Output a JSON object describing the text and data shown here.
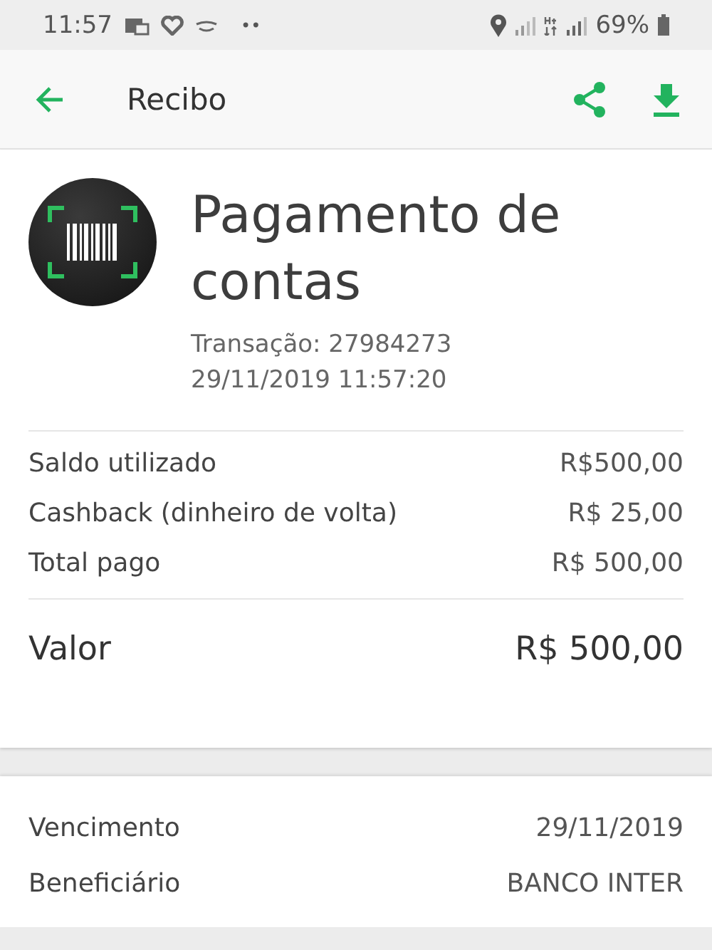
{
  "status_bar": {
    "time": "11:57",
    "notification_dots": "••",
    "battery": "69%"
  },
  "app_bar": {
    "title": "Recibo"
  },
  "receipt": {
    "title": "Pagamento de contas",
    "transaction": "Transação: 27984273",
    "datetime": "29/11/2019 11:57:20",
    "lines": [
      {
        "label": "Saldo utilizado",
        "value": "R$500,00"
      },
      {
        "label": "Cashback (dinheiro de volta)",
        "value": "R$ 25,00"
      },
      {
        "label": "Total pago",
        "value": "R$ 500,00"
      }
    ],
    "total": {
      "label": "Valor",
      "value": "R$ 500,00"
    }
  },
  "details": [
    {
      "label": "Vencimento",
      "value": "29/11/2019"
    },
    {
      "label": "Beneficiário",
      "value": "BANCO INTER"
    }
  ]
}
